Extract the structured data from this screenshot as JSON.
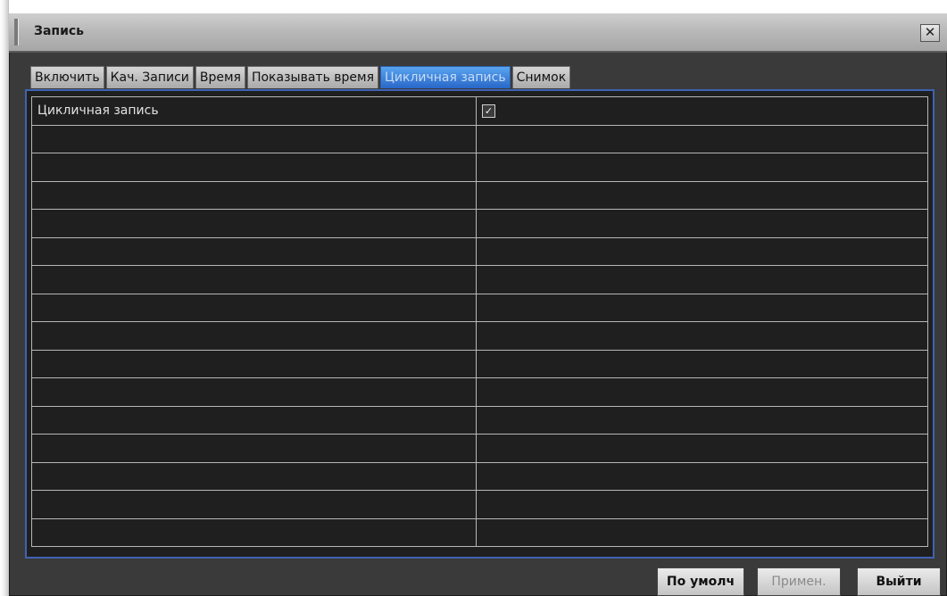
{
  "window": {
    "title": "Запись",
    "close_symbol": "✕"
  },
  "tabs": [
    {
      "label": "Включить",
      "active": false
    },
    {
      "label": "Кач. Записи",
      "active": false
    },
    {
      "label": "Время",
      "active": false
    },
    {
      "label": "Показывать время",
      "active": false
    },
    {
      "label": "Цикличная запись",
      "active": true
    },
    {
      "label": "Снимок",
      "active": false
    }
  ],
  "settings": {
    "loop_record": {
      "label": "Цикличная запись",
      "checked": true,
      "check_symbol": "✓"
    }
  },
  "buttons": {
    "default_label": "По умолч",
    "apply_label": "Примен.",
    "exit_label": "Выйти"
  },
  "colors": {
    "active_tab": "#2f74d6",
    "panel_border": "#3f63b3",
    "panel_bg": "#1f1f1f"
  }
}
